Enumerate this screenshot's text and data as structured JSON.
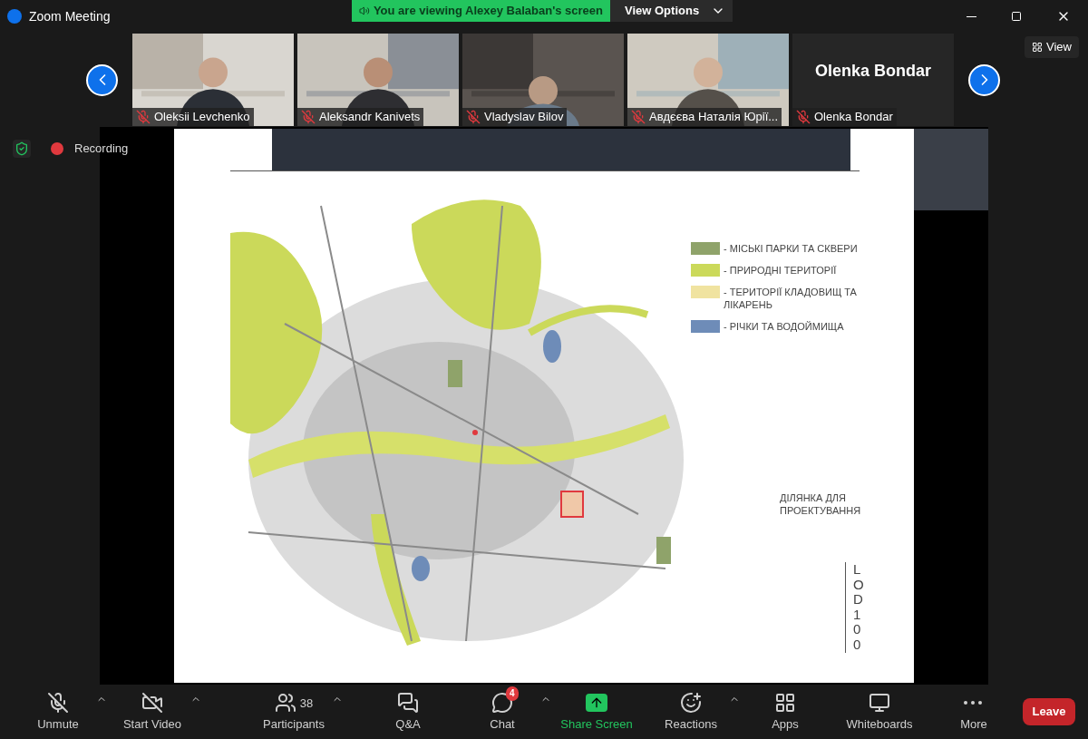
{
  "window": {
    "title": "Zoom Meeting"
  },
  "share_banner": {
    "text": "You are viewing Alexey Balaban's screen",
    "options": "View Options"
  },
  "view_button": "View",
  "participants": [
    {
      "name": "Oleksii Levchenko",
      "muted": true,
      "video": true
    },
    {
      "name": "Aleksandr Kanivets",
      "muted": true,
      "video": true
    },
    {
      "name": "Vladyslav Bilov",
      "muted": true,
      "video": true
    },
    {
      "name": "Авдєєва Наталія Юрії...",
      "muted": true,
      "video": true
    },
    {
      "name": "Olenka Bondar",
      "muted": true,
      "video": false,
      "display_name": "Olenka Bondar"
    }
  ],
  "status": {
    "recording": "Recording"
  },
  "slide": {
    "legend": [
      {
        "label": "- МІСЬКІ ПАРКИ ТА СКВЕРИ",
        "color": "#8fa36a"
      },
      {
        "label": "- ПРИРОДНІ ТЕРИТОРІЇ",
        "color": "#cbd95a"
      },
      {
        "label": "- ТЕРИТОРІЇ КЛАДОВИЩ ТА ЛІКАРЕНЬ",
        "color": "#f0e3a0"
      },
      {
        "label": "- РІЧКИ ТА ВОДОЙМИЩА",
        "color": "#6e8cb8"
      }
    ],
    "site_label": "ДІЛЯНКА ДЛЯ ПРОЕКТУВАННЯ",
    "lod": "LOD100"
  },
  "toolbar": [
    {
      "kind": "mic",
      "label": "Unmute",
      "caret": true
    },
    {
      "kind": "video",
      "label": "Start Video",
      "caret": true
    },
    {
      "kind": "participants",
      "label": "Participants",
      "count": "38",
      "caret": true
    },
    {
      "kind": "qa",
      "label": "Q&A",
      "caret": false
    },
    {
      "kind": "chat",
      "label": "Chat",
      "badge": "4",
      "caret": true
    },
    {
      "kind": "share",
      "label": "Share Screen",
      "caret": false
    },
    {
      "kind": "reactions",
      "label": "Reactions",
      "caret": true
    },
    {
      "kind": "apps",
      "label": "Apps",
      "caret": false
    },
    {
      "kind": "whiteboards",
      "label": "Whiteboards",
      "caret": false
    },
    {
      "kind": "more",
      "label": "More",
      "caret": false
    }
  ],
  "leave_button": "Leave"
}
